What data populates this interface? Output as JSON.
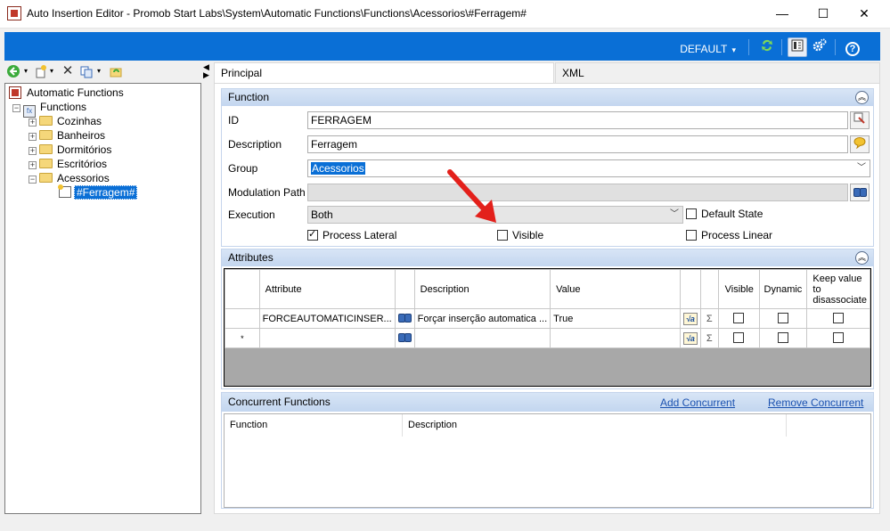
{
  "window": {
    "title": "Auto Insertion Editor - Promob Start Labs\\System\\Automatic Functions\\Functions\\Acessorios\\#Ferragem#",
    "minimize": "—",
    "maximize": "☐",
    "close": "✕"
  },
  "toolbar": {
    "profile": "DEFAULT",
    "profile_arrow": "▾",
    "help": "?"
  },
  "tree": {
    "root": "Automatic Functions",
    "functions": "Functions",
    "items": [
      "Cozinhas",
      "Banheiros",
      "Dormitórios",
      "Escritórios",
      "Acessorios"
    ],
    "selected": "#Ferragem#"
  },
  "tabs": {
    "principal": "Principal",
    "xml": "XML"
  },
  "function_panel": {
    "title": "Function",
    "id_label": "ID",
    "id_value": "FERRAGEM",
    "description_label": "Description",
    "description_value": "Ferragem",
    "group_label": "Group",
    "group_value": "Acessorios",
    "modulation_label": "Modulation Path",
    "modulation_value": "",
    "execution_label": "Execution",
    "execution_value": "Both",
    "default_state": "Default State",
    "process_lateral": "Process Lateral",
    "visible": "Visible",
    "process_linear": "Process Linear"
  },
  "attributes_panel": {
    "title": "Attributes",
    "columns": [
      "Attribute",
      "Description",
      "Value",
      "Visible",
      "Dynamic",
      "Keep value to disassociate"
    ],
    "rows": [
      {
        "attribute": "FORCEAUTOMATICINSER...",
        "description": "Forçar inserção automatica ...",
        "value": "True"
      }
    ],
    "new_row_marker": "*",
    "sigma": "Σ"
  },
  "concurrent_panel": {
    "title": "Concurrent Functions",
    "add": "Add Concurrent",
    "remove": "Remove Concurrent",
    "columns": [
      "Function",
      "Description"
    ]
  },
  "colors": {
    "accent": "#0a6fd6",
    "annotation_arrow": "#e3201b"
  }
}
